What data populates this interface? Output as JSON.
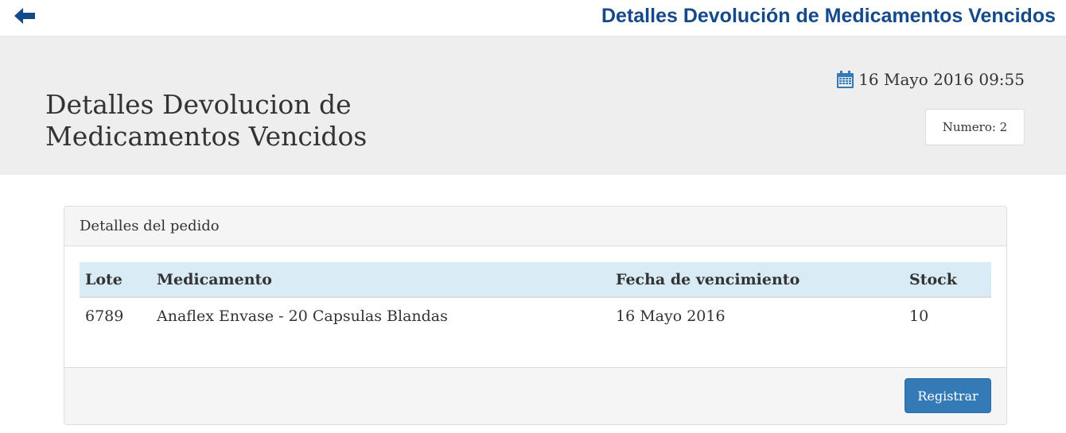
{
  "topbar": {
    "title": "Detalles Devolución de Medicamentos Vencidos",
    "back_icon": "arrow-left-icon"
  },
  "hero": {
    "title": "Detalles Devolucion de Medicamentos Vencidos",
    "date_icon": "calendar-icon",
    "date": "16 Mayo 2016 09:55",
    "numero_label": "Numero: 2"
  },
  "panel": {
    "heading": "Detalles del pedido",
    "columns": [
      "Lote",
      "Medicamento",
      "Fecha de vencimiento",
      "Stock"
    ],
    "rows": [
      {
        "lote": "6789",
        "medicamento": "Anaflex Envase - 20 Capsulas Blandas",
        "fecha": "16 Mayo 2016",
        "stock": "10"
      }
    ],
    "submit_label": "Registrar"
  },
  "colors": {
    "brand_blue": "#154a8a",
    "button_blue": "#337ab7",
    "table_header": "#d9ecf5",
    "hero_bg": "#eeeeee"
  }
}
